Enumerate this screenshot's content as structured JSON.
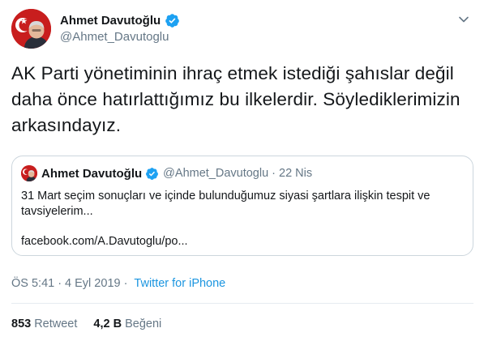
{
  "author": {
    "display_name": "Ahmet Davutoğlu",
    "handle": "@Ahmet_Davutoglu",
    "avatar_icon": "profile-photo-with-flag"
  },
  "tweet": {
    "text_lines": [
      "AK Parti yönetiminin ihraç etmek istediği şahıslar değil",
      "daha önce hatırlattığımız bu ilkelerdir. Söylediklerimizin",
      "arkasındayız."
    ]
  },
  "quoted": {
    "display_name": "Ahmet Davutoğlu",
    "handle": "@Ahmet_Davutoglu",
    "separator": "·",
    "date": "22 Nis",
    "body_lines": [
      "31 Mart seçim sonuçları ve içinde bulunduğumuz siyasi şartlara ilişkin tespit ve",
      "tavsiyelerim..."
    ],
    "link": "facebook.com/A.Davutoglu/po..."
  },
  "meta": {
    "time": "ÖS 5:41",
    "separator": "·",
    "date": "4 Eyl 2019",
    "separator2": "·",
    "source": "Twitter for iPhone"
  },
  "stats": {
    "retweet_count": "853",
    "retweet_label": "Retweet",
    "like_count": "4,2 B",
    "like_label": "Beğeni"
  },
  "colors": {
    "verified": "#1da1f2",
    "link": "#1b95e0",
    "muted": "#657786",
    "border": "#ccd6dd"
  }
}
